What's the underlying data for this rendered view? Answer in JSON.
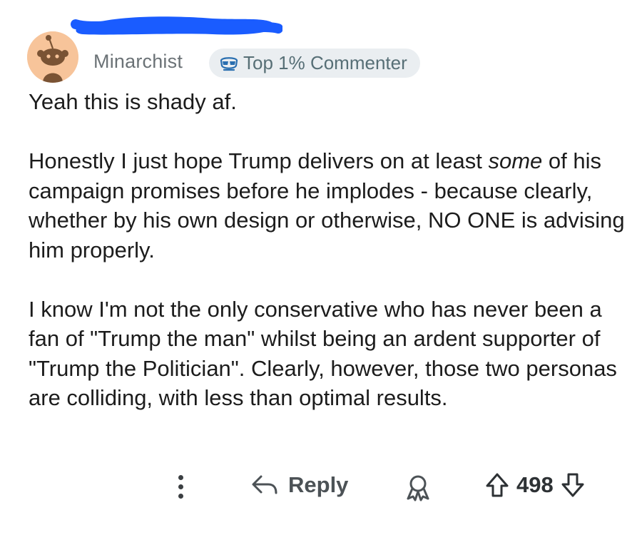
{
  "comment": {
    "username": "Minarchist",
    "flair": {
      "label": "Top 1% Commenter",
      "icon": "sunglasses-icon"
    },
    "paragraphs": [
      "Yeah this is shady af.",
      "–",
      "I know I'm not the only conservative who has never been a fan of \"Trump the man\" whilst being an ardent supporter of \"Trump the Politician\". Clearly, however, those two personas are colliding, with less than optimal results."
    ],
    "paragraph2": {
      "lead": "Honestly I just hope Trump delivers on at least",
      "emphasis": "some",
      "rest": "of his campaign promises before he implodes - because clearly, whether by his own design or otherwise, NO ONE is advising him properly."
    }
  },
  "actions": {
    "more_icon": "more-vertical-icon",
    "reply_label": "Reply",
    "reply_icon": "reply-arrow-icon",
    "award_icon": "award-icon",
    "upvote_icon": "upvote-arrow-icon",
    "downvote_icon": "downvote-arrow-icon",
    "vote_count": "498"
  },
  "colors": {
    "redaction": "#1a5cff",
    "avatar_bg": "#f7c49a",
    "flair_bg": "#eaeef1"
  }
}
